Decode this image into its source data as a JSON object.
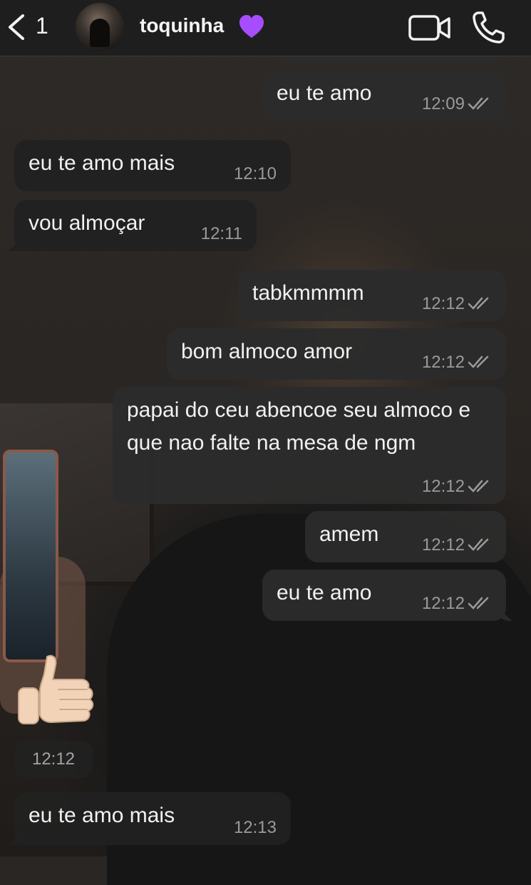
{
  "header": {
    "back_count": "1",
    "contact_name": "toquinha",
    "icons": [
      "back-chevron-icon",
      "purple-heart-icon",
      "video-camera-icon",
      "phone-icon"
    ],
    "heart_color": "#a64dff"
  },
  "messages": [
    {
      "direction": "outgoing",
      "text": "eu te amo",
      "time": "12:09",
      "status": "read"
    },
    {
      "direction": "incoming",
      "text": "eu te amo mais",
      "time": "12:10"
    },
    {
      "direction": "incoming",
      "text": "vou almoçar",
      "time": "12:11"
    },
    {
      "direction": "outgoing",
      "text": "tabkmmmm",
      "time": "12:12",
      "status": "read"
    },
    {
      "direction": "outgoing",
      "text": "bom almoco amor",
      "time": "12:12",
      "status": "read"
    },
    {
      "direction": "outgoing",
      "text": "papai do ceu abencoe seu almoco e que nao falte na mesa de ngm",
      "time": "12:12",
      "status": "read"
    },
    {
      "direction": "outgoing",
      "text": "amem",
      "time": "12:12",
      "status": "read"
    },
    {
      "direction": "outgoing",
      "text": "eu te amo",
      "time": "12:12",
      "status": "read"
    },
    {
      "direction": "incoming",
      "emoji": "thumbs-up-icon",
      "time": "12:12"
    },
    {
      "direction": "incoming",
      "text": "eu te amo mais",
      "time": "12:13"
    }
  ],
  "colors": {
    "outgoing_bubble": "#2b2b2b",
    "incoming_bubble": "#212121",
    "text": "#f1f1f1",
    "timestamp": "#9a9a9a"
  }
}
